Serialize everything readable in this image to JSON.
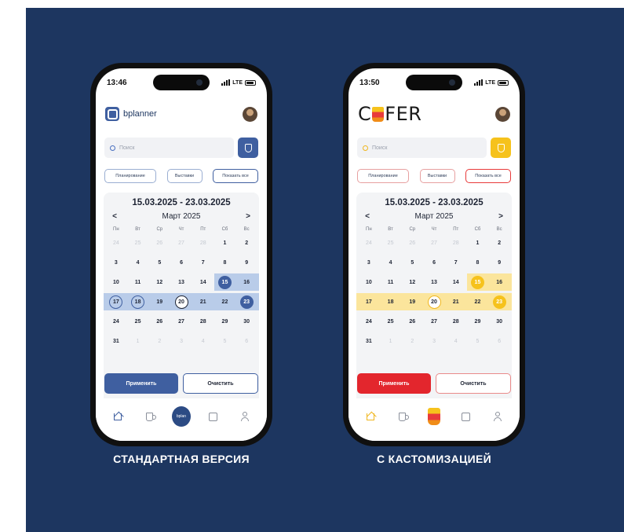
{
  "left_phone": {
    "status": {
      "time": "13:46",
      "network": "LTE"
    },
    "brand_name": "bplanner",
    "search": {
      "placeholder": "Поиск"
    },
    "chips": [
      "Планирование",
      "Выставки",
      "Показать все"
    ],
    "calendar": {
      "range": "15.03.2025 - 23.03.2025",
      "month": "Март 2025",
      "prev": "<",
      "next": ">",
      "weekdays": [
        "Пн",
        "Вт",
        "Ср",
        "Чт",
        "Пт",
        "Сб",
        "Вс"
      ],
      "weeks": [
        [
          "24",
          "25",
          "26",
          "27",
          "28",
          "1",
          "2"
        ],
        [
          "3",
          "4",
          "5",
          "6",
          "7",
          "8",
          "9"
        ],
        [
          "10",
          "11",
          "12",
          "13",
          "14",
          "15",
          "16"
        ],
        [
          "17",
          "18",
          "19",
          "20",
          "21",
          "22",
          "23"
        ],
        [
          "24",
          "25",
          "26",
          "27",
          "28",
          "29",
          "30"
        ],
        [
          "31",
          "1",
          "2",
          "3",
          "4",
          "5",
          "6"
        ]
      ]
    },
    "actions": {
      "apply": "Применить",
      "clear": "Очистить"
    },
    "tab_center_label": "bplan",
    "caption": "СТАНДАРТНАЯ ВЕРСИЯ"
  },
  "right_phone": {
    "status": {
      "time": "13:50",
      "network": "LTE"
    },
    "brand_name_pre": "C",
    "brand_name_post": "FER",
    "search": {
      "placeholder": "Поиск"
    },
    "chips": [
      "Планирование",
      "Выставки",
      "Показать все"
    ],
    "calendar": {
      "range": "15.03.2025 - 23.03.2025",
      "month": "Март 2025",
      "prev": "<",
      "next": ">",
      "weekdays": [
        "Пн",
        "Вт",
        "Ср",
        "Чт",
        "Пт",
        "Сб",
        "Вс"
      ],
      "weeks": [
        [
          "24",
          "25",
          "26",
          "27",
          "28",
          "1",
          "2"
        ],
        [
          "3",
          "4",
          "5",
          "6",
          "7",
          "8",
          "9"
        ],
        [
          "10",
          "11",
          "12",
          "13",
          "14",
          "15",
          "16"
        ],
        [
          "17",
          "18",
          "19",
          "20",
          "21",
          "22",
          "23"
        ],
        [
          "24",
          "25",
          "26",
          "27",
          "28",
          "29",
          "30"
        ],
        [
          "31",
          "1",
          "2",
          "3",
          "4",
          "5",
          "6"
        ]
      ]
    },
    "actions": {
      "apply": "Применить",
      "clear": "Очистить"
    },
    "caption": "С КАСТОМИЗАЦИЕЙ"
  },
  "colors": {
    "board_bg": "#1d3660",
    "standard_accent": "#3f5fa0",
    "standard_range": "#b9cce9",
    "custom_accent_yellow": "#f6c21c",
    "custom_accent_red": "#e3262d",
    "custom_range": "#fbe59c"
  },
  "icons": [
    "search-icon",
    "filter-icon",
    "home-icon",
    "cup-icon",
    "card-icon",
    "profile-icon"
  ]
}
